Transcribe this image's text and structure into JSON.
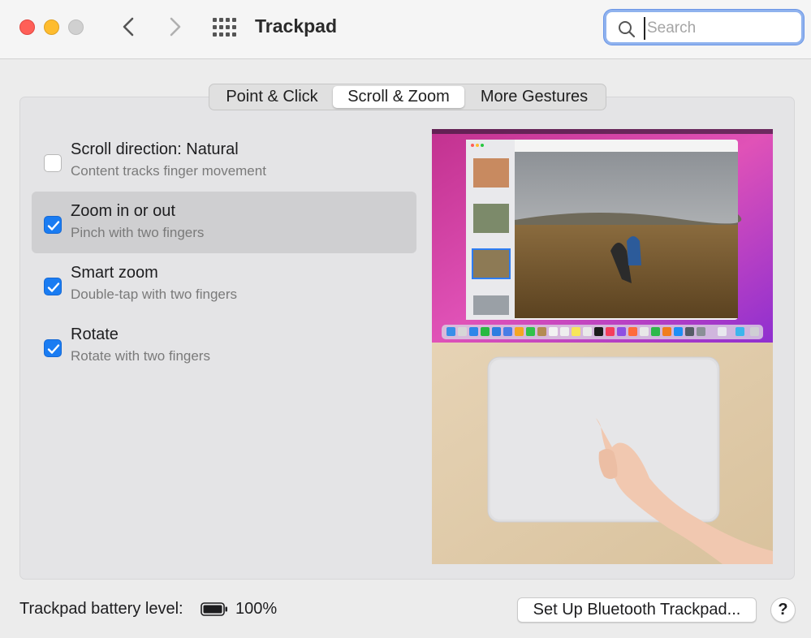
{
  "window": {
    "title": "Trackpad",
    "search_placeholder": "Search",
    "search_value": ""
  },
  "tabs": [
    {
      "label": "Point & Click",
      "selected": false
    },
    {
      "label": "Scroll & Zoom",
      "selected": true
    },
    {
      "label": "More Gestures",
      "selected": false
    }
  ],
  "options": [
    {
      "title": "Scroll direction: Natural",
      "subtitle": "Content tracks finger movement",
      "checked": false,
      "selected": false
    },
    {
      "title": "Zoom in or out",
      "subtitle": "Pinch with two fingers",
      "checked": true,
      "selected": true
    },
    {
      "title": "Smart zoom",
      "subtitle": "Double-tap with two fingers",
      "checked": true,
      "selected": false
    },
    {
      "title": "Rotate",
      "subtitle": "Rotate with two fingers",
      "checked": true,
      "selected": false
    }
  ],
  "footer": {
    "battery_label": "Trackpad battery level:",
    "battery_value": "100%",
    "setup_button": "Set Up Bluetooth Trackpad...",
    "help_button": "?"
  },
  "icons": {
    "back": "chevron-left-icon",
    "forward": "chevron-right-icon",
    "show_all": "grid-icon",
    "search": "search-icon",
    "battery": "battery-icon",
    "checkbox": "checkmark-icon"
  },
  "colors": {
    "accent": "#1a7cf2",
    "close": "#ff5f57",
    "minimize": "#febc2e",
    "zoom_disabled": "#d0d0d0"
  }
}
